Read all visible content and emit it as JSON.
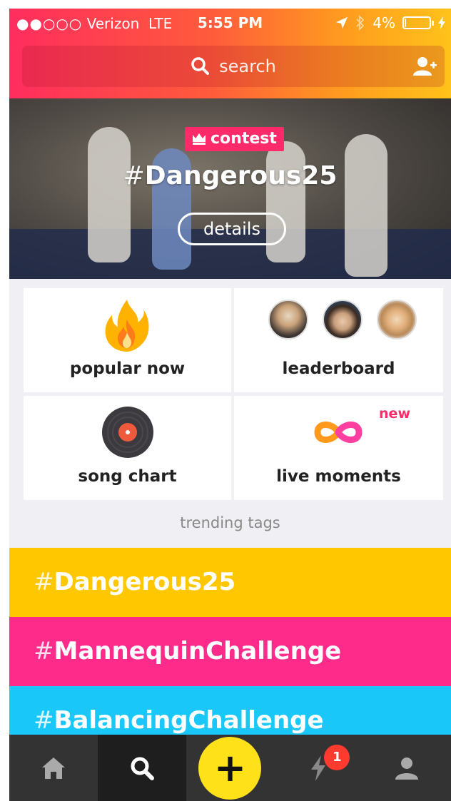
{
  "status_bar": {
    "signal": "●●○○○",
    "carrier": "Verizon",
    "network": "LTE",
    "time": "5:55 PM",
    "battery": "4%",
    "battery_level": 0.04
  },
  "search": {
    "placeholder": "search"
  },
  "contest": {
    "badge": "contest",
    "hash": "#",
    "tag": "Dangerous25",
    "details_label": "details"
  },
  "tiles": {
    "popular": "popular now",
    "leaderboard": "leaderboard",
    "song_chart": "song chart",
    "live_moments": "live moments",
    "new_badge": "new"
  },
  "trending": {
    "heading": "trending tags",
    "tags": [
      {
        "hash": "#",
        "name": "Dangerous25",
        "color": "#ffc700"
      },
      {
        "hash": "#",
        "name": "MannequinChallenge",
        "color": "#ff2b8b"
      },
      {
        "hash": "#",
        "name": "BalancingChallenge",
        "color": "#19c8f8"
      }
    ]
  },
  "tabbar": {
    "notification_count": "1",
    "plus_label": "+",
    "icons": [
      "home-icon",
      "search-icon",
      "create-plus-icon",
      "lightning-icon",
      "profile-icon"
    ]
  }
}
